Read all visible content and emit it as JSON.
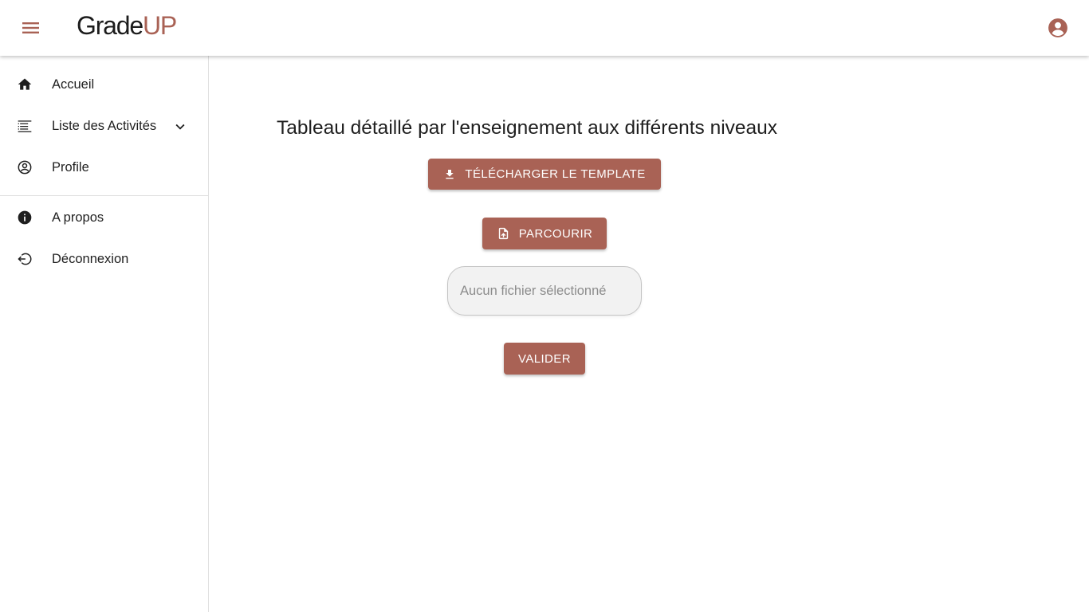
{
  "app": {
    "logo_part1": "Grade",
    "logo_part2": "UP",
    "brand_color": "#a96255"
  },
  "topbar": {
    "menu_icon": "hamburger-menu-icon",
    "account_icon": "account-circle-icon"
  },
  "sidebar": {
    "items": [
      {
        "label": "Accueil",
        "icon": "home-icon"
      },
      {
        "label": "Liste des Activités",
        "icon": "list-icon",
        "expand_icon": "chevron-down-icon"
      },
      {
        "label": "Profile",
        "icon": "account-circle-outline-icon"
      },
      {
        "label": "A propos",
        "icon": "info-icon"
      },
      {
        "label": "Déconnexion",
        "icon": "logout-icon"
      }
    ]
  },
  "main": {
    "title": "Tableau détaillé par l'enseignement aux différents niveaux",
    "download_label": "Télécharger le template",
    "browse_label": "Parcourir",
    "file_placeholder": "Aucun fichier sélectionné",
    "file_value": "",
    "validate_label": "Valider"
  }
}
